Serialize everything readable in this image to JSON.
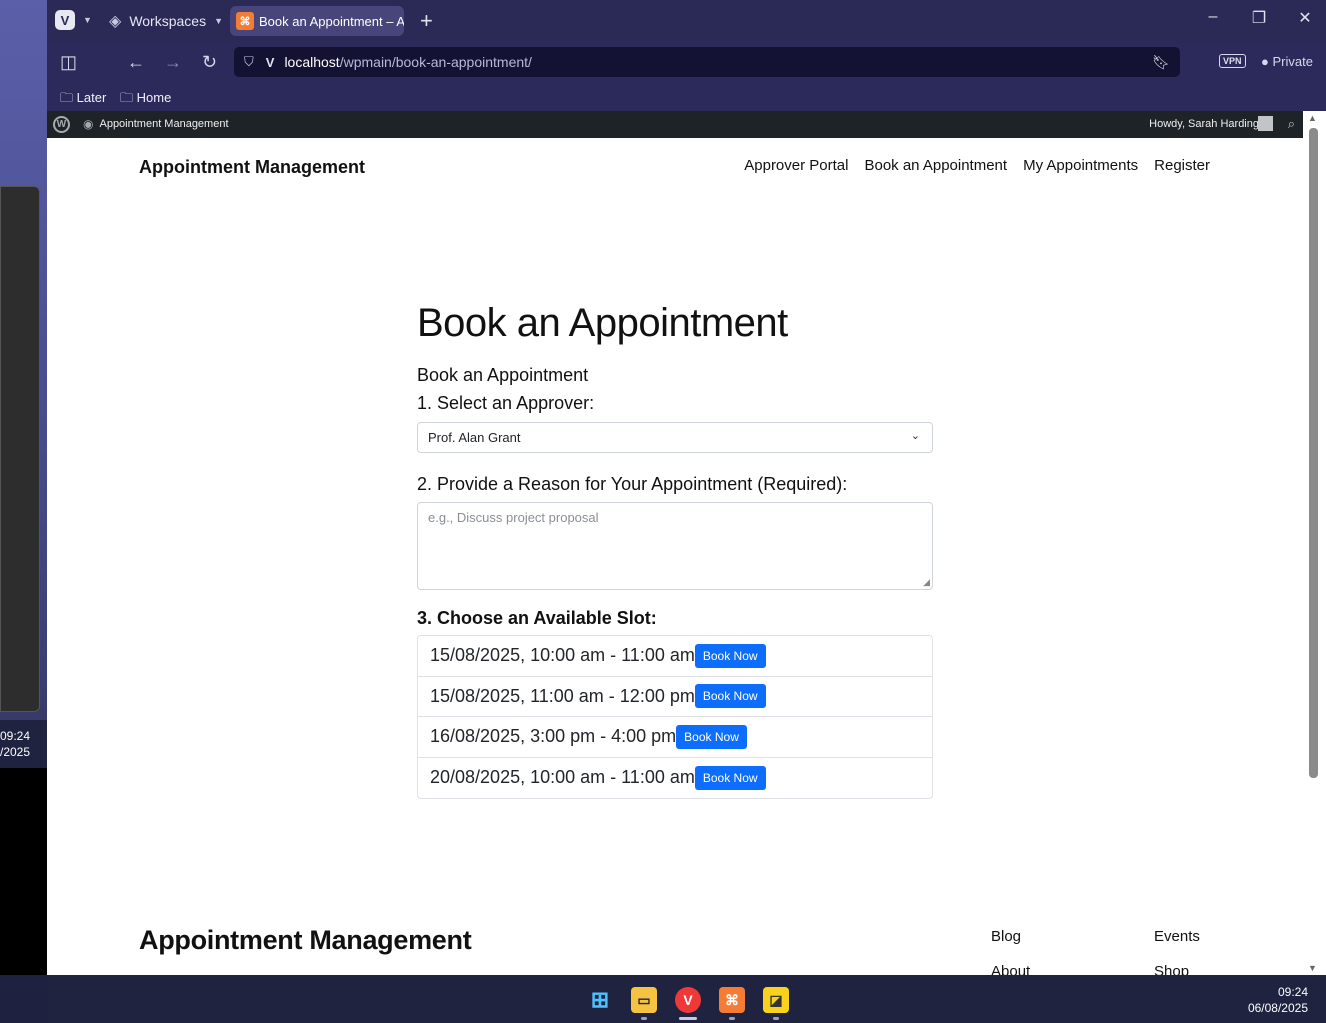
{
  "desktop": {
    "clock_time": "09:24",
    "clock_date": "/2025"
  },
  "browser": {
    "workspaces_label": "Workspaces",
    "active_tab_title": "Book an Appointment – Ap",
    "url_host": "localhost",
    "url_path": "/wpmain/book-an-appointment/",
    "vpn_label": "VPN",
    "private_label": "Private",
    "bookmarks": [
      "Later",
      "Home"
    ]
  },
  "wp_admin_bar": {
    "site_name": "Appointment Management",
    "howdy": "Howdy, Sarah Harding"
  },
  "site": {
    "title": "Appointment Management",
    "nav": [
      "Approver Portal",
      "Book an Appointment",
      "My Appointments",
      "Register"
    ]
  },
  "page": {
    "heading": "Book an Appointment",
    "form_heading": "Book an Appointment",
    "step1_label": "1. Select an Approver:",
    "approver_selected": "Prof. Alan Grant",
    "step2_label": "2. Provide a Reason for Your Appointment (Required):",
    "reason_placeholder": "e.g., Discuss project proposal",
    "step3_label": "3. Choose an Available Slot:",
    "slots": [
      {
        "label": "15/08/2025, 10:00 am - 11:00 am",
        "button": "Book Now"
      },
      {
        "label": "15/08/2025, 11:00 am - 12:00 pm",
        "button": "Book Now"
      },
      {
        "label": "16/08/2025, 3:00 pm - 4:00 pm",
        "button": "Book Now"
      },
      {
        "label": "20/08/2025, 10:00 am - 11:00 am",
        "button": "Book Now"
      }
    ]
  },
  "footer": {
    "title": "Appointment Management",
    "links_col1": [
      "Blog",
      "About"
    ],
    "links_col2": [
      "Events",
      "Shop"
    ]
  },
  "taskbar": {
    "time": "09:24",
    "date": "06/08/2025"
  },
  "colors": {
    "primary_button": "#0d6efd",
    "browser_chrome": "#2c2a5a",
    "admin_bar": "#1d2327"
  }
}
